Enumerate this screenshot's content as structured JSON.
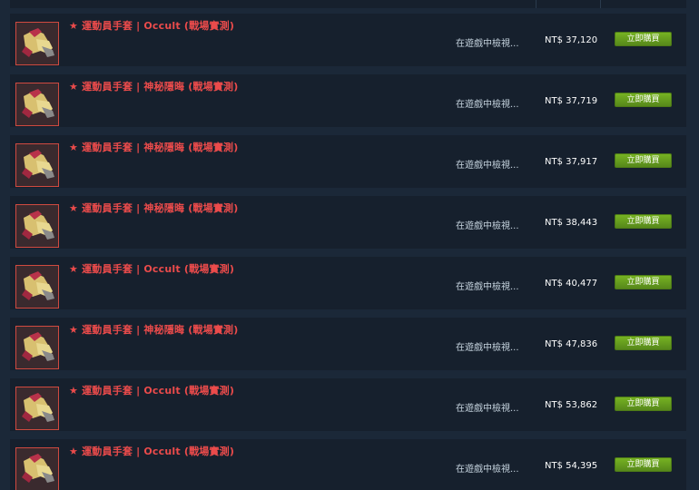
{
  "listings": [
    {
      "name": "★ 運動員手套 | Occult (戰場實測)",
      "inspect_label": "在遊戲中檢視...",
      "price": "NT$ 37,120",
      "buy_label": "立即購買"
    },
    {
      "name": "★ 運動員手套 | 神秘隱晦 (戰場實測)",
      "inspect_label": "在遊戲中檢視...",
      "price": "NT$ 37,719",
      "buy_label": "立即購買"
    },
    {
      "name": "★ 運動員手套 | 神秘隱晦 (戰場實測)",
      "inspect_label": "在遊戲中檢視...",
      "price": "NT$ 37,917",
      "buy_label": "立即購買"
    },
    {
      "name": "★ 運動員手套 | 神秘隱晦 (戰場實測)",
      "inspect_label": "在遊戲中檢視...",
      "price": "NT$ 38,443",
      "buy_label": "立即購買"
    },
    {
      "name": "★ 運動員手套 | Occult (戰場實測)",
      "inspect_label": "在遊戲中檢視...",
      "price": "NT$ 40,477",
      "buy_label": "立即購買"
    },
    {
      "name": "★ 運動員手套 | 神秘隱晦 (戰場實測)",
      "inspect_label": "在遊戲中檢視...",
      "price": "NT$ 47,836",
      "buy_label": "立即購買"
    },
    {
      "name": "★ 運動員手套 | Occult (戰場實測)",
      "inspect_label": "在遊戲中檢視...",
      "price": "NT$ 53,862",
      "buy_label": "立即購買"
    },
    {
      "name": "★ 運動員手套 | Occult (戰場實測)",
      "inspect_label": "在遊戲中檢視...",
      "price": "NT$ 54,395",
      "buy_label": "立即購買"
    }
  ],
  "item_icon": "sport-glove-icon",
  "colors": {
    "background": "#1b2838",
    "row_background": "#16202d",
    "item_name": "#eb4b4b",
    "buy_button": "#75b022",
    "price_text": "#ffffff"
  }
}
